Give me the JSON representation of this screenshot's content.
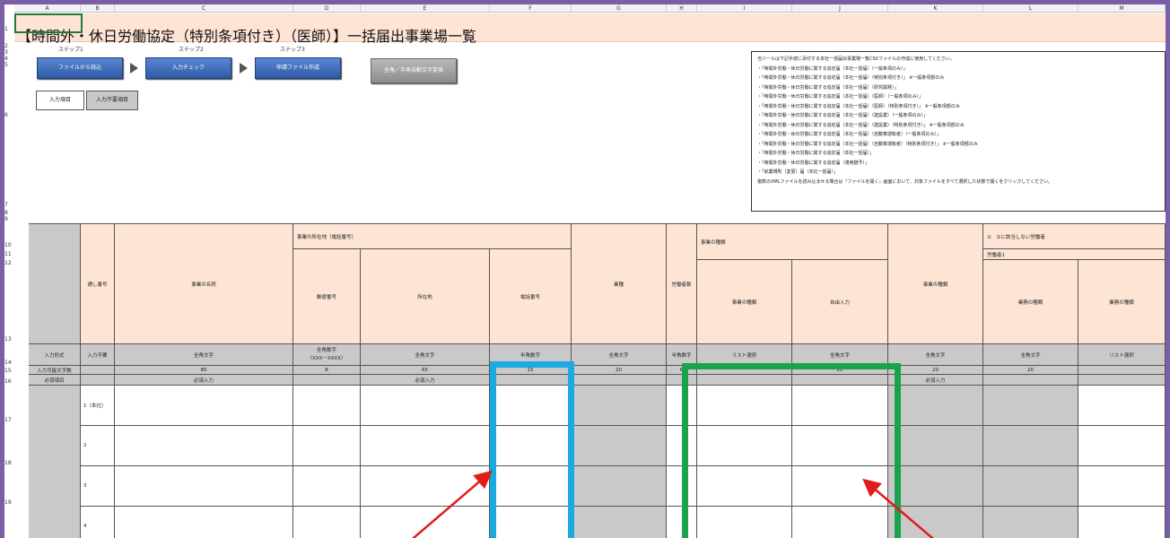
{
  "sheet": {
    "columns": [
      "A",
      "B",
      "C",
      "D",
      "E",
      "F",
      "G",
      "H",
      "I",
      "J",
      "K",
      "L",
      "M"
    ],
    "rows": [
      "1",
      "2",
      "3",
      "4",
      "5",
      "6",
      "7",
      "8",
      "9",
      "10",
      "11",
      "12",
      "13",
      "14",
      "15",
      "16",
      "17",
      "18",
      "19"
    ]
  },
  "title": "【時間外・休日労働協定（特別条項付き）（医師）】一括届出事業場一覧",
  "steps": {
    "step1": "ステップ1",
    "step2": "ステップ2",
    "step3": "ステップ3",
    "load_button": "ファイルから読込",
    "check_button": "入力チェック",
    "create_button": "申請ファイル作成",
    "convert_button": "全角／半角自動文字変換"
  },
  "legend": {
    "input_item": "入力項目",
    "not_required_item": "入力不要項目"
  },
  "info_lines": [
    "当ツールは下記手続に添付する本社一括届出事業場一覧CSVファイルの作成に使用してください。",
    "・「時間外労働・休日労働に関する協定届（本社一括届）（一般条項のみ）」",
    "・「時間外労働・休日労働に関する協定届（本社一括届）（特別条項付き）」 ※一般条項部のみ",
    "・「時間外労働・休日労働に関する協定届（本社一括届）（研究開発）」",
    "・「時間外労働・休日労働に関する協定届（本社一括届）（医師）（一般条項のみ）」",
    "・「時間外労働・休日労働に関する協定届（本社一括届）（医師）（特別条項付き）」 ※一般条項部のみ",
    "・「時間外労働・休日労働に関する協定届（本社一括届）（建設業）（一般条項のみ）」",
    "・「時間外労働・休日労働に関する協定届（本社一括届）（建設業）（特別条項付き）」 ※一般条項部のみ",
    "・「時間外労働・休日労働に関する協定届（本社一括届）（自動車運転者）（一般条項のみ）」",
    "・「時間外労働・休日労働に関する協定届（本社一括届）（自動車運転者）（特別条項付き）」 ※一般条項部のみ",
    "・「時間外労働・休日労働に関する協定届（本社一括届）」",
    "・「時間外労働・休日労働に関する協定届（適用猶予）」",
    "・「就業規則（変更）届（本社一括届）」",
    "複数のXMLファイルを読み込ませる場合は『ファイルを開く』画面において、対象ファイルをすべて選択した状態で開くをクリックしてください。"
  ],
  "table": {
    "h_location": "事業の所在地（電話番号）",
    "h_business_type": "事業の種類",
    "h_workers_group": "①　②に該当しない労働者",
    "h_worker1": "労働者1",
    "c_serial": "通し番号",
    "c_name": "事業の名称",
    "c_postal": "郵便番号",
    "c_address": "所在地",
    "c_phone": "電話番号",
    "c_industry": "業種",
    "c_workers": "労働者数",
    "c_biz_kind": "事業の種類",
    "c_free": "自由入力",
    "c_biz_kind2": "事業の種類",
    "c_job_kind": "業務の種類",
    "c_job_kind2": "業務の種類",
    "format_label": "入力形式",
    "format": [
      "入力不要",
      "全角文字",
      "全角数字",
      "全角文字",
      "半角数字",
      "全角文字",
      "半角数字",
      "リスト選択",
      "全角文字",
      "全角文字",
      "全角文字",
      "リスト選択"
    ],
    "postal_format_note": "（XXX－XXXX）",
    "maxlen_label": "入力可能文字数",
    "maxlen": [
      "",
      "80",
      "8",
      "65",
      "15",
      "20",
      "6",
      "",
      "20",
      "20",
      "20",
      ""
    ],
    "required_label": "必須項目",
    "required_name": "必須入力",
    "required_address": "必須入力",
    "required_biz": "必須入力",
    "row_numbers": [
      "1（本社）",
      "2",
      "3",
      "4"
    ]
  }
}
